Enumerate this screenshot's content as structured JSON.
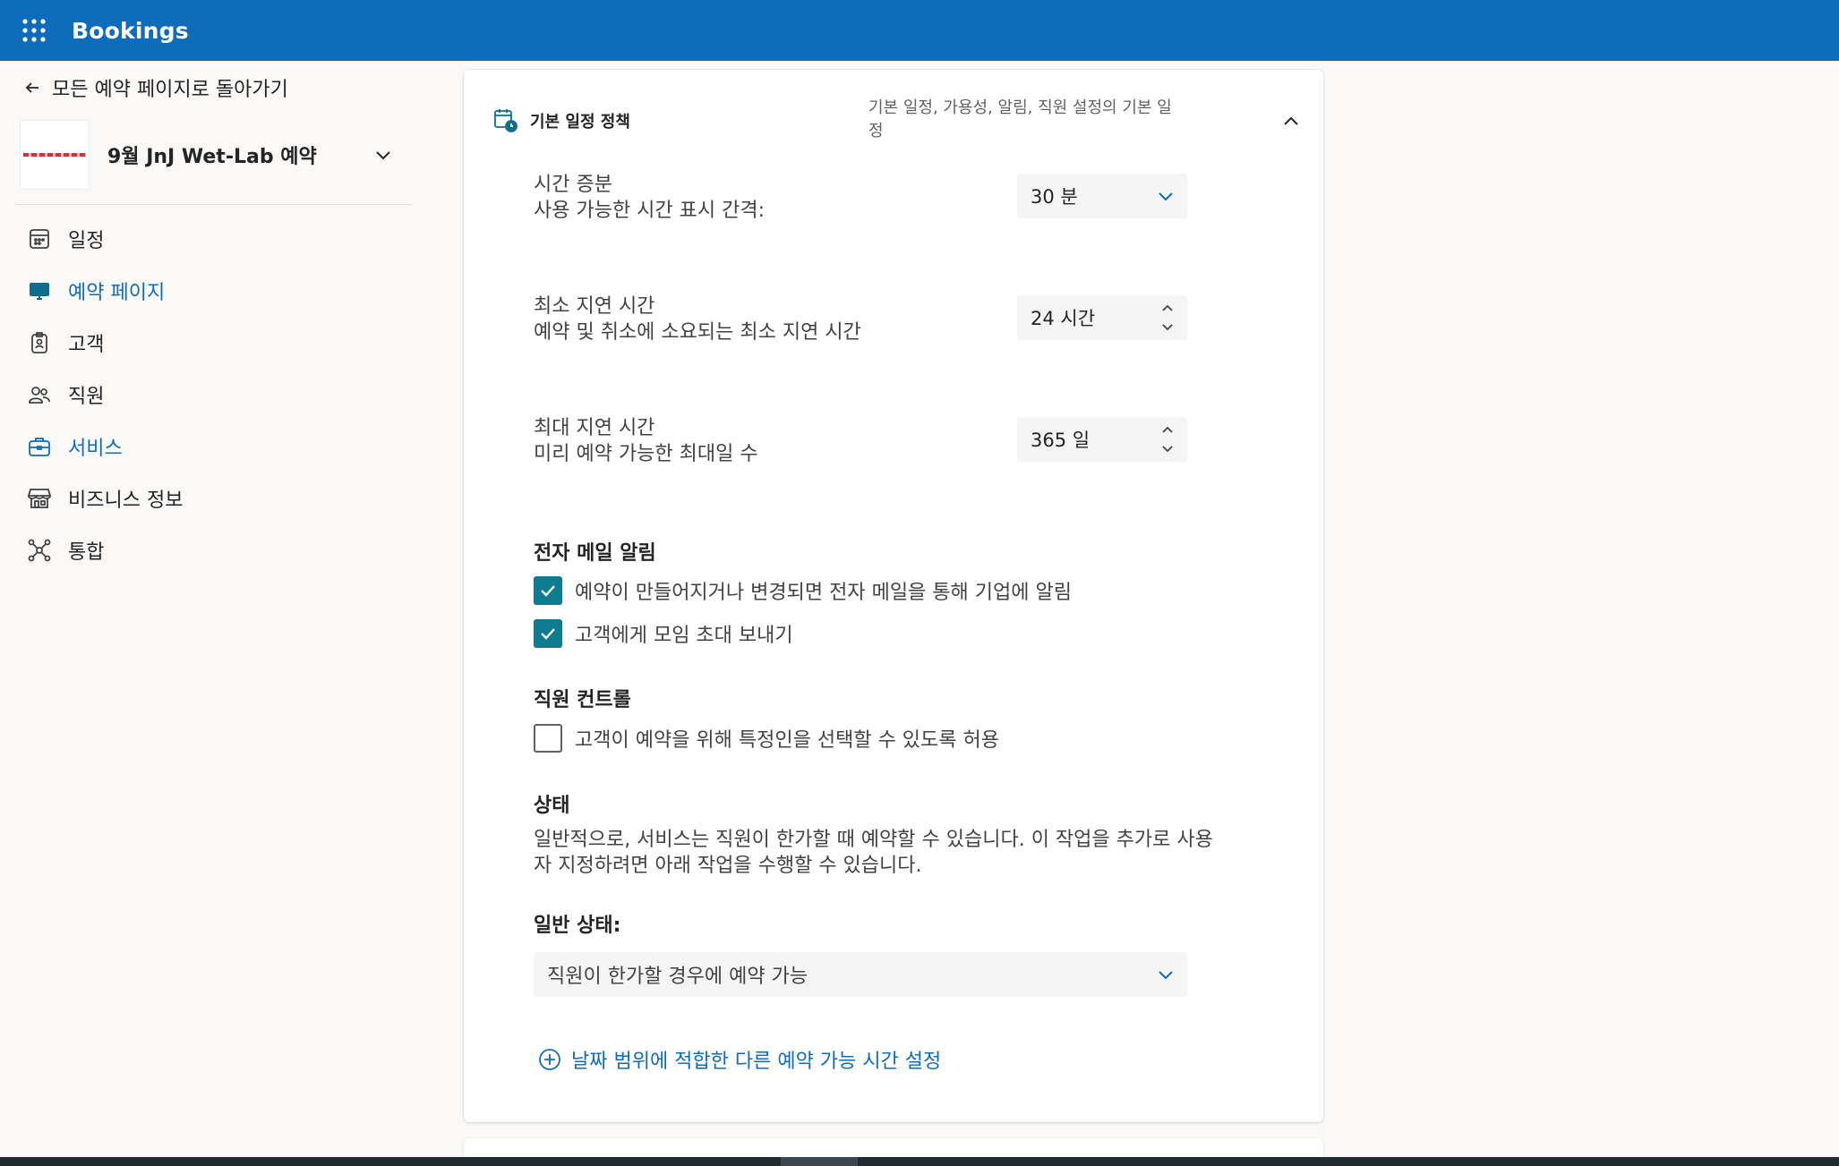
{
  "app": {
    "title": "Bookings"
  },
  "sidebar": {
    "back_label": "모든 예약 페이지로 돌아가기",
    "page_name": "9월 JnJ Wet-Lab 예약",
    "items": [
      {
        "label": "일정",
        "icon": "calendar-icon",
        "active": false
      },
      {
        "label": "예약 페이지",
        "icon": "monitor-icon",
        "active": true
      },
      {
        "label": "고객",
        "icon": "contact-card-icon",
        "active": false
      },
      {
        "label": "직원",
        "icon": "people-icon",
        "active": false
      },
      {
        "label": "서비스",
        "icon": "briefcase-icon",
        "active": true
      },
      {
        "label": "비즈니스 정보",
        "icon": "store-icon",
        "active": false
      },
      {
        "label": "통합",
        "icon": "integration-icon",
        "active": false
      }
    ]
  },
  "card": {
    "title": "기본 일정 정책",
    "description": "기본 일정, 가용성, 알림, 직원 설정의 기본 일정",
    "time_increment": {
      "label": "시간 증분",
      "sub": "사용 가능한 시간 표시 간격:",
      "value": "30 분"
    },
    "min_lead": {
      "label": "최소 지연 시간",
      "sub": "예약 및 취소에 소요되는 최소 지연 시간",
      "value": "24 시간"
    },
    "max_lead": {
      "label": "최대 지연 시간",
      "sub": "미리 예약 가능한 최대일 수",
      "value": "365 일"
    },
    "email": {
      "title": "전자 메일 알림",
      "opt1": {
        "label": "예약이 만들어지거나 변경되면 전자 메일을 통해 기업에 알림",
        "checked": true
      },
      "opt2": {
        "label": "고객에게 모임 초대 보내기",
        "checked": true
      }
    },
    "staff": {
      "title": "직원 컨트롤",
      "opt1": {
        "label": "고객이 예약을 위해 특정인을 선택할 수 있도록 허용",
        "checked": false
      }
    },
    "status": {
      "title": "상태",
      "text": "일반적으로, 서비스는 직원이 한가할 때 예약할 수 있습니다. 이 작업을 추가로 사용자 지정하려면 아래 작업을 수행할 수 있습니다.",
      "general_label": "일반 상태:",
      "general_value": "직원이 한가할 경우에 예약 가능"
    },
    "add_link": "날짜 범위에 적합한 다른 예약 가능 시간 설정"
  },
  "colors": {
    "brand": "#0f6cbd",
    "checkbox": "#0f7b8e"
  }
}
